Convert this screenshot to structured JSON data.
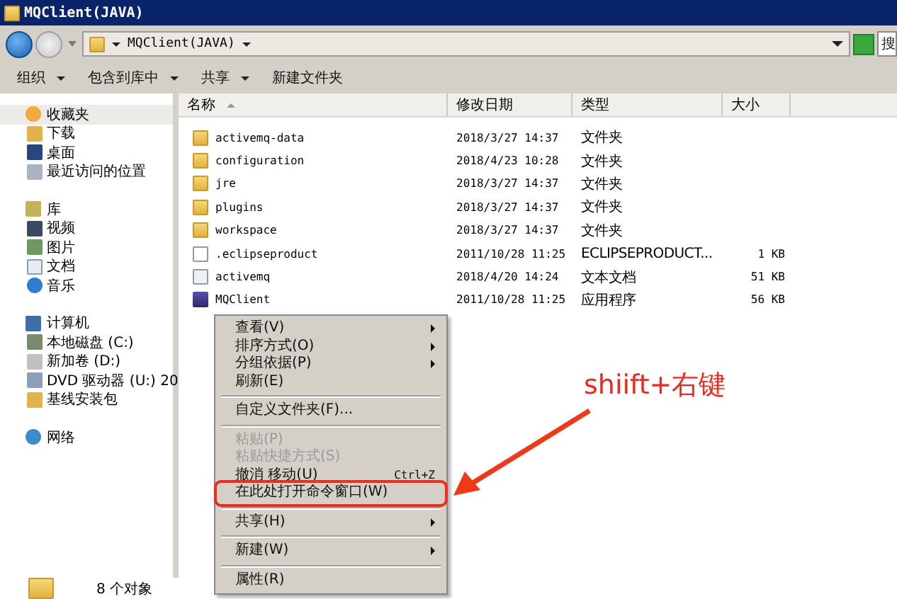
{
  "window": {
    "title": "MQClient(JAVA)"
  },
  "address_bar": {
    "path": "MQClient(JAVA)",
    "search_placeholder": "搜"
  },
  "toolbar": [
    {
      "label": "组织",
      "has_menu": true
    },
    {
      "label": "包含到库中",
      "has_menu": true
    },
    {
      "label": "共享",
      "has_menu": true
    },
    {
      "label": "新建文件夹",
      "has_menu": false
    }
  ],
  "sidebar": {
    "groups": [
      {
        "label": "收藏夹",
        "selected": true,
        "children": [
          {
            "label": "下载"
          },
          {
            "label": "桌面"
          },
          {
            "label": "最近访问的位置"
          }
        ]
      },
      {
        "label": "库",
        "selected": false,
        "children": [
          {
            "label": "视频"
          },
          {
            "label": "图片"
          },
          {
            "label": "文档"
          },
          {
            "label": "音乐"
          }
        ]
      },
      {
        "label": "计算机",
        "selected": false,
        "children": [
          {
            "label": "本地磁盘 (C:)"
          },
          {
            "label": "新加卷 (D:)"
          },
          {
            "label": "DVD 驱动器 (U:) 20"
          },
          {
            "label": "基线安装包"
          }
        ]
      },
      {
        "label": "网络",
        "selected": false
      }
    ]
  },
  "table": {
    "columns": [
      "名称",
      "修改日期",
      "类型",
      "大小"
    ],
    "rows": [
      {
        "kind": "folder",
        "name": "activemq-data",
        "date": "2018/3/27 14:37",
        "type": "文件夹",
        "size": ""
      },
      {
        "kind": "folder",
        "name": "configuration",
        "date": "2018/4/23 10:28",
        "type": "文件夹",
        "size": ""
      },
      {
        "kind": "folder",
        "name": "jre",
        "date": "2018/3/27 14:37",
        "type": "文件夹",
        "size": ""
      },
      {
        "kind": "folder",
        "name": "plugins",
        "date": "2018/3/27 14:37",
        "type": "文件夹",
        "size": ""
      },
      {
        "kind": "folder",
        "name": "workspace",
        "date": "2018/3/27 14:37",
        "type": "文件夹",
        "size": ""
      },
      {
        "kind": "file",
        "name": ".eclipseproduct",
        "date": "2011/10/28 11:25",
        "type": "ECLIPSEPRODUCT...",
        "size": "1 KB"
      },
      {
        "kind": "text",
        "name": "activemq",
        "date": "2018/4/20 14:24",
        "type": "文本文档",
        "size": "51 KB"
      },
      {
        "kind": "app",
        "name": "MQClient",
        "date": "2011/10/28 11:25",
        "type": "应用程序",
        "size": "56 KB"
      }
    ]
  },
  "context_menu": {
    "groups": [
      [
        {
          "label": "查看(V)",
          "submenu": true,
          "disabled": false,
          "marked": false
        },
        {
          "label": "排序方式(O)",
          "submenu": true,
          "disabled": false,
          "marked": false
        },
        {
          "label": "分组依据(P)",
          "submenu": true,
          "disabled": false,
          "marked": false
        },
        {
          "label": "刷新(E)",
          "submenu": false,
          "disabled": false,
          "marked": false
        }
      ],
      [
        {
          "label": "自定义文件夹(F)...",
          "submenu": false,
          "disabled": false,
          "marked": false
        }
      ],
      [
        {
          "label": "粘贴(P)",
          "submenu": false,
          "disabled": true,
          "marked": false
        },
        {
          "label": "粘贴快捷方式(S)",
          "submenu": false,
          "disabled": true,
          "marked": false
        },
        {
          "label": "撤消 移动(U)",
          "shortcut": "Ctrl+Z",
          "submenu": false,
          "disabled": false,
          "marked": false
        },
        {
          "label": "在此处打开命令窗口(W)",
          "submenu": false,
          "disabled": false,
          "marked": true
        }
      ],
      [
        {
          "label": "共享(H)",
          "submenu": true,
          "disabled": false,
          "marked": false
        }
      ],
      [
        {
          "label": "新建(W)",
          "submenu": true,
          "disabled": false,
          "marked": false
        }
      ],
      [
        {
          "label": "属性(R)",
          "submenu": false,
          "disabled": false,
          "marked": false
        }
      ]
    ]
  },
  "annotation": {
    "text": "shiift+右键"
  },
  "status_bar": {
    "text": "8 个对象"
  }
}
